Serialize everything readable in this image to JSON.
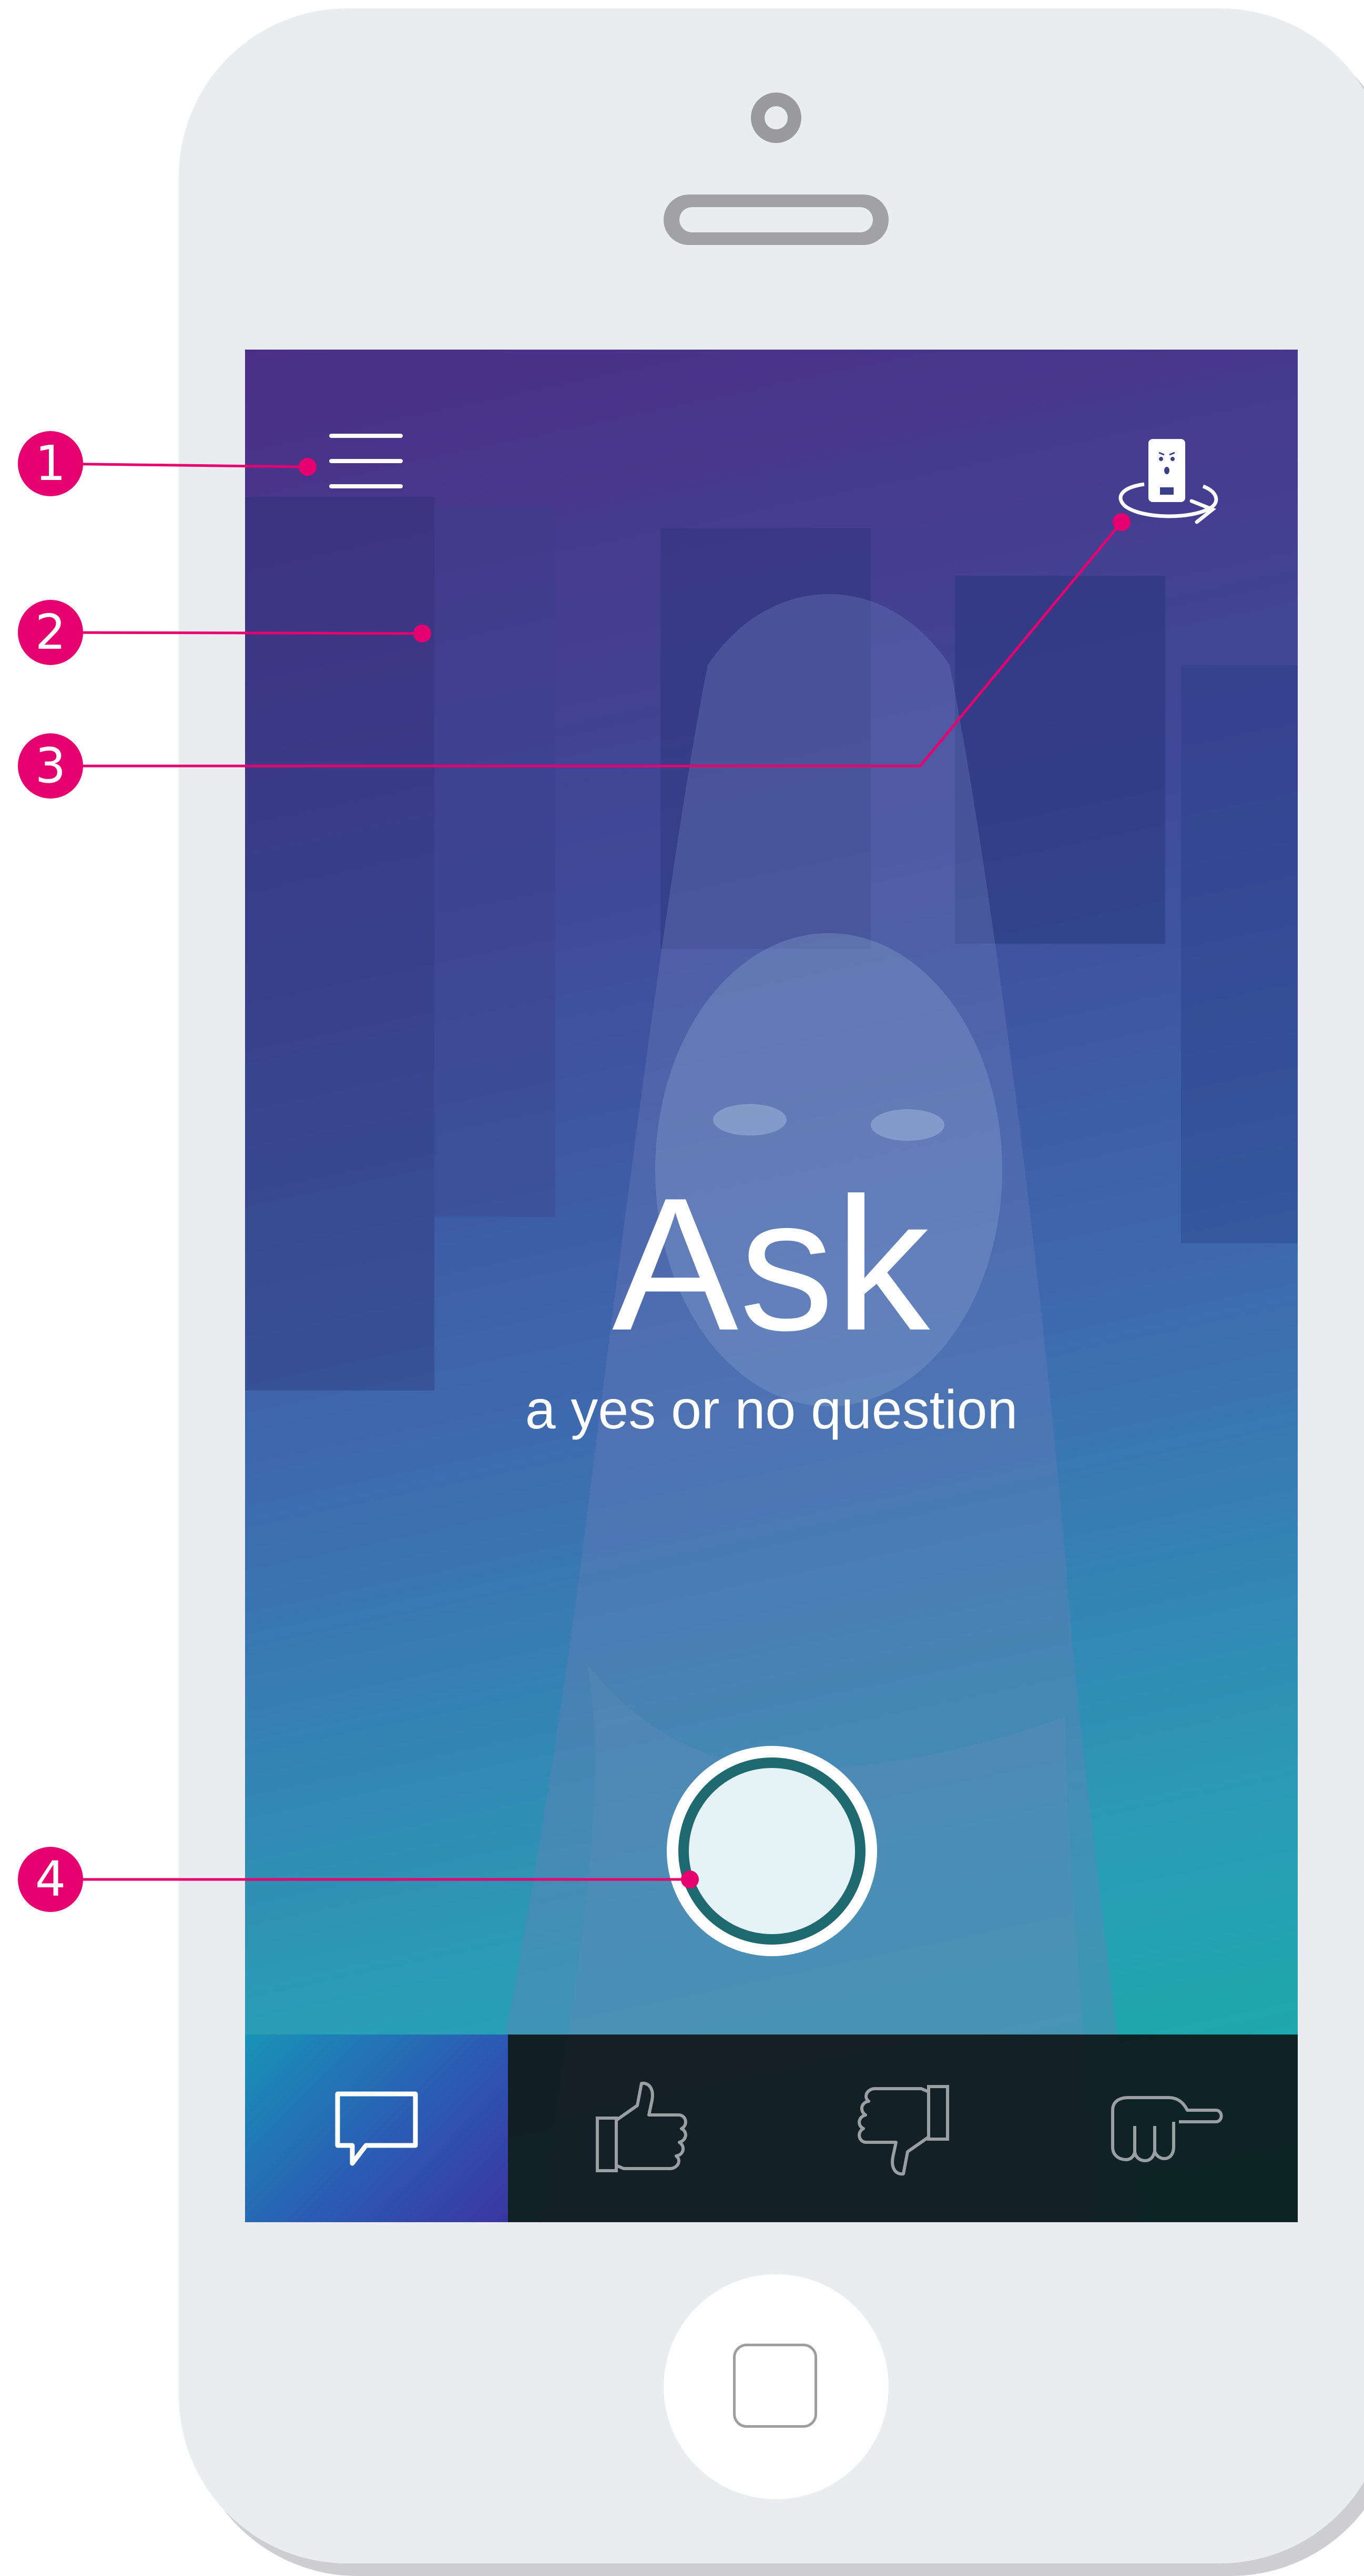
{
  "screen": {
    "title": "Ask",
    "subtitle": "a yes or no question"
  },
  "icons": {
    "menu": "hamburger-menu-icon",
    "camera_flip": "flip-camera-icon",
    "shutter": "record-button",
    "tabs": [
      "speech-bubble-icon",
      "thumbs-up-icon",
      "thumbs-down-icon",
      "pointing-hand-icon"
    ],
    "home": "home-button"
  },
  "tabs": [
    {
      "name": "ask",
      "icon": "speech-bubble-icon",
      "active": true
    },
    {
      "name": "yes",
      "icon": "thumbs-up-icon",
      "active": false
    },
    {
      "name": "no",
      "icon": "thumbs-down-icon",
      "active": false
    },
    {
      "name": "point",
      "icon": "pointing-hand-icon",
      "active": false
    }
  ],
  "annotations": [
    "1",
    "2",
    "3",
    "4"
  ],
  "colors": {
    "annotation": "#e6006f",
    "gradient_top": "#4b2f86",
    "gradient_bottom": "#13b4a4",
    "phone_body": "#ebecf0"
  }
}
